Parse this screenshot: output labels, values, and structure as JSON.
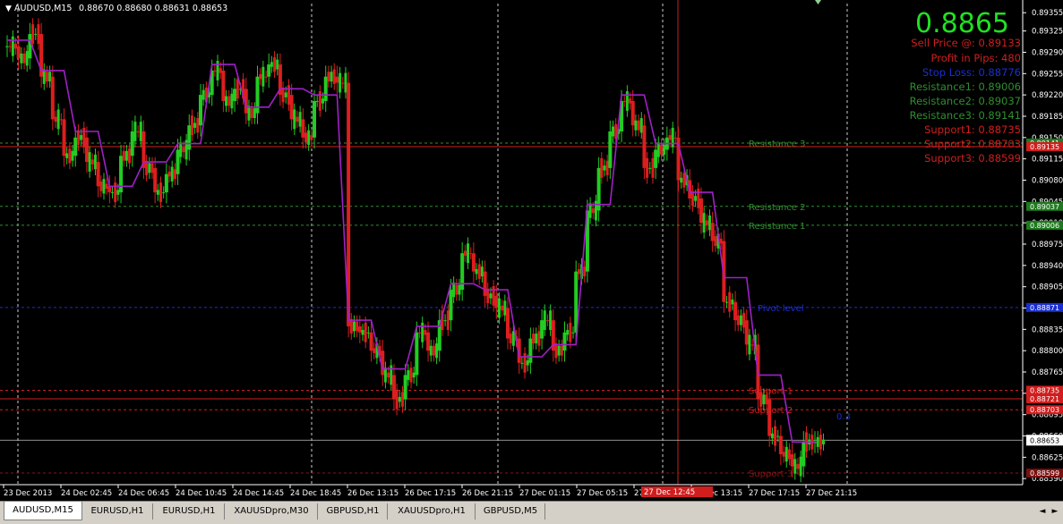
{
  "chart_data": {
    "type": "candlestick",
    "title": "AUDUSD,M15",
    "ohlc_header": "0.88670 0.88680 0.88631 0.88653",
    "ylim": [
      0.8858,
      0.8937
    ],
    "yticks": [
      "0.89355",
      "0.89325",
      "0.89290",
      "0.89255",
      "0.89220",
      "0.89185",
      "0.89150",
      "0.89115",
      "0.89080",
      "0.89045",
      "0.89010",
      "0.88975",
      "0.88940",
      "0.88905",
      "0.88870",
      "0.88835",
      "0.88800",
      "0.88765",
      "0.88730",
      "0.88695",
      "0.88660",
      "0.88625",
      "0.88590"
    ],
    "xticks": [
      "23 Dec 2013",
      "24 Dec 02:45",
      "24 Dec 06:45",
      "24 Dec 10:45",
      "24 Dec 14:45",
      "24 Dec 18:45",
      "26 Dec 13:15",
      "26 Dec 17:15",
      "26 Dec 21:15",
      "27 Dec 01:15",
      "27 Dec 05:15",
      "27 Dec 09:15",
      "27 Dec 13:15",
      "27 Dec 17:15",
      "27 Dec 21:15"
    ],
    "crosshair_label": "27 Dec 12:45",
    "current_price": "0.88653",
    "levels": [
      {
        "name": "Resistance 3",
        "label": "Resistance 3",
        "value": 0.89141,
        "tag": "0.89141",
        "color": "#2f8f2f",
        "tag_bg": "#1e7a1e"
      },
      {
        "name": "Resistance 2",
        "label": "Resistance 2",
        "value": 0.89037,
        "tag": "0.89037",
        "color": "#2f8f2f",
        "tag_bg": "#1e7a1e"
      },
      {
        "name": "Resistance 1",
        "label": "Resistance 1",
        "value": 0.89006,
        "tag": "0.89006",
        "color": "#2f8f2f",
        "tag_bg": "#1e7a1e"
      },
      {
        "name": "Pivot level",
        "label": "Pivot level",
        "value": 0.88871,
        "tag": "0.88871",
        "color": "#1a2fd0",
        "tag_bg": "#1a2fd0"
      },
      {
        "name": "Support 1",
        "label": "Support 1",
        "value": 0.88735,
        "tag": "0.88735",
        "color": "#d01e1e",
        "tag_bg": "#d01e1e"
      },
      {
        "name": "Support 2",
        "label": "Support 2",
        "value": 0.88703,
        "tag": "0.88703",
        "color": "#d01e1e",
        "tag_bg": "#d01e1e"
      },
      {
        "name": "Support 3",
        "label": "Support 3",
        "value": 0.88599,
        "tag": "0.88599",
        "color": "#8a1414",
        "tag_bg": "#7a1010"
      }
    ],
    "extra_tags": [
      {
        "value": 0.89135,
        "tag": "0.89135",
        "bg": "#d01e1e"
      },
      {
        "value": 0.88721,
        "tag": "0.88721",
        "bg": "#d01e1e"
      }
    ],
    "series": [
      {
        "name": "closes",
        "values": [
          0.893,
          0.8928,
          0.8932,
          0.8925,
          0.8918,
          0.8912,
          0.8915,
          0.8911,
          0.8907,
          0.8906,
          0.8912,
          0.8916,
          0.891,
          0.8906,
          0.8909,
          0.8913,
          0.8917,
          0.8922,
          0.8926,
          0.8921,
          0.8923,
          0.8919,
          0.8925,
          0.8927,
          0.8922,
          0.8918,
          0.8915,
          0.8921,
          0.8925,
          0.8924,
          0.8884,
          0.8883,
          0.888,
          0.8876,
          0.8872,
          0.8876,
          0.8883,
          0.888,
          0.8885,
          0.889,
          0.8896,
          0.8893,
          0.8889,
          0.8887,
          0.8882,
          0.8878,
          0.8882,
          0.8885,
          0.888,
          0.8883,
          0.8893,
          0.8903,
          0.891,
          0.8916,
          0.8921,
          0.8917,
          0.891,
          0.8913,
          0.8915,
          0.8908,
          0.8905,
          0.8901,
          0.8898,
          0.8888,
          0.8885,
          0.8881,
          0.8872,
          0.8866,
          0.8863,
          0.8861,
          0.8865,
          0.8865
        ]
      }
    ],
    "indicator_line_color": "#a020c8"
  },
  "info_panel": {
    "price": "0.8865",
    "sell_price": "Sell Price @: 0.89133",
    "profit": "Profit in Pips: 480",
    "stop_loss": "Stop Loss: 0.88776",
    "r1": "Resistance1: 0.89006",
    "r2": "Resistance2: 0.89037",
    "r3": "Resistance3: 0.89141",
    "s1": "Support1: 0.88735",
    "s2": "Support2: 0.88703",
    "s3": "Support3: 0.88599"
  },
  "marker_03": "0.3",
  "tabs": [
    "AUDUSD,M15",
    "EURUSD,H1",
    "EURUSD,H1",
    "XAUUSDpro,M30",
    "GBPUSD,H1",
    "XAUUSDpro,H1",
    "GBPUSD,M5"
  ],
  "colors": {
    "bull": "#22cc22",
    "bear": "#dd1e1e",
    "grid": "#ffffff",
    "axis_text": "#ffffff"
  }
}
